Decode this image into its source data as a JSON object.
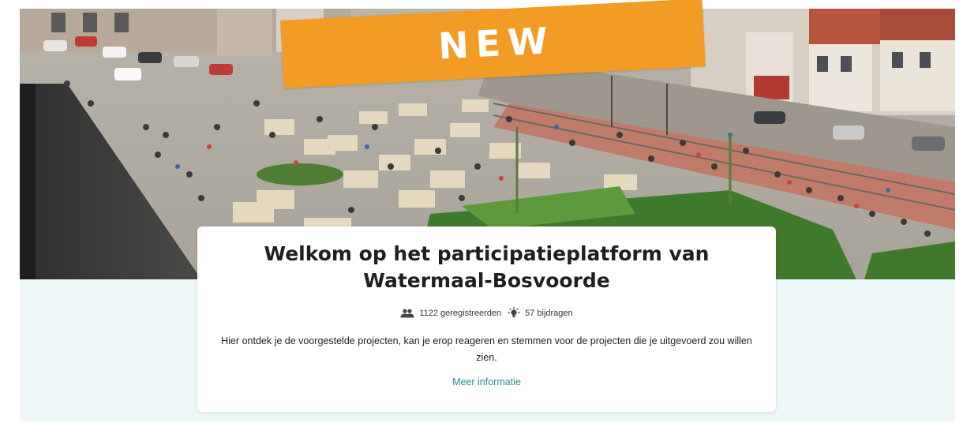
{
  "banner": {
    "badge_label": "NEW",
    "badge_color": "#f29c25"
  },
  "hero": {
    "image_icon": "town-square-photo"
  },
  "card": {
    "title": "Welkom op het participatieplatform van Watermaal-Bosvoorde",
    "stats": {
      "registered_label": "1122 geregistreerden",
      "registered_icon": "users-icon",
      "contributions_label": "57 bijdragen",
      "contributions_icon": "lightbulb-icon"
    },
    "description": "Hier ontdek je de voorgestelde projecten, kan je erop reageren en stemmen voor de projecten die je uitgevoerd zou willen zien.",
    "more_info_label": "Meer informatie",
    "link_color": "#2a8a8a"
  }
}
